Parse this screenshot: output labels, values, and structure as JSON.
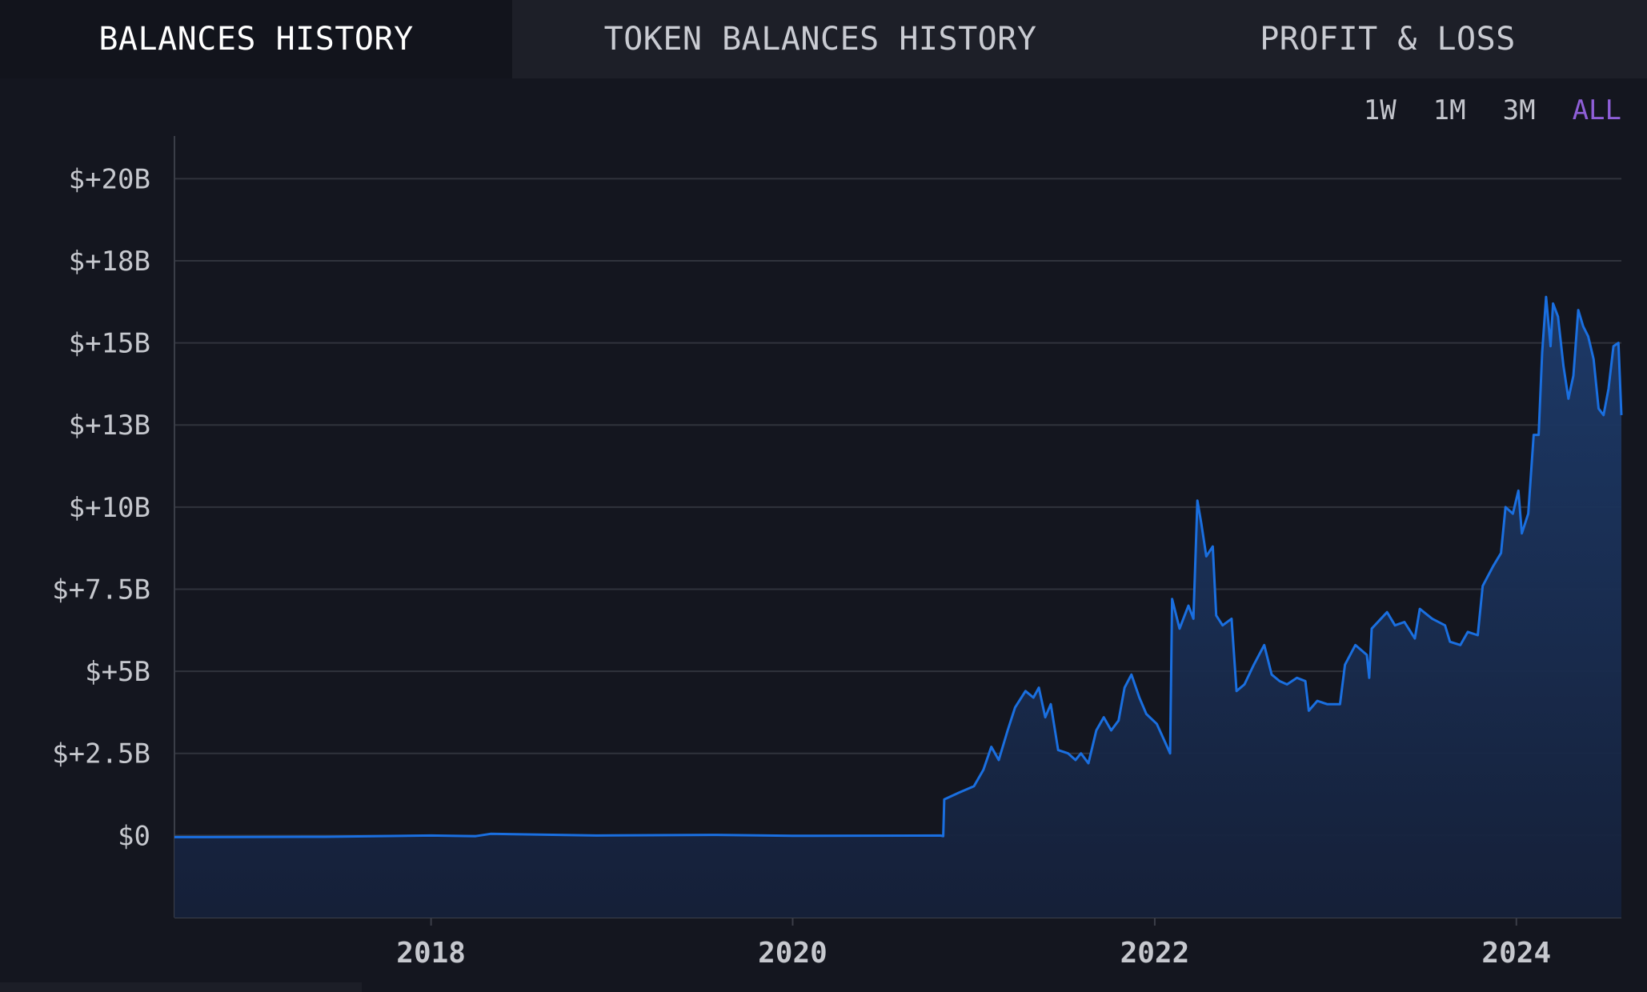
{
  "tabs": [
    {
      "label": "BALANCES HISTORY",
      "active": true
    },
    {
      "label": "TOKEN BALANCES HISTORY",
      "active": false
    },
    {
      "label": "PROFIT & LOSS",
      "active": false
    }
  ],
  "ranges": [
    {
      "label": "1W",
      "active": false
    },
    {
      "label": "1M",
      "active": false
    },
    {
      "label": "3M",
      "active": false
    },
    {
      "label": "ALL",
      "active": true
    }
  ],
  "colors": {
    "background": "#14161f",
    "line": "#1a6fe0",
    "area_top": "#1d3b6b",
    "area_bottom": "#152039",
    "grid": "#30333c",
    "active_range": "#8f5fd8"
  },
  "chart_data": {
    "type": "area",
    "title": "",
    "xlabel": "",
    "ylabel": "",
    "x_ticks": [
      "2018",
      "2020",
      "2022",
      "2024"
    ],
    "y_ticks": [
      {
        "value": 0,
        "label": "$0"
      },
      {
        "value": 2.5,
        "label": "$+2.5B"
      },
      {
        "value": 5,
        "label": "$+5B"
      },
      {
        "value": 7.5,
        "label": "$+7.5B"
      },
      {
        "value": 10,
        "label": "$+10B"
      },
      {
        "value": 12.5,
        "label": "$+13B"
      },
      {
        "value": 15,
        "label": "$+15B"
      },
      {
        "value": 17.5,
        "label": "$+18B"
      },
      {
        "value": 20,
        "label": "$+20B"
      }
    ],
    "xlim": [
      "2016-08-01",
      "2024-07-31"
    ],
    "ylim": [
      -2.5,
      21.3
    ],
    "grid": true,
    "series": [
      {
        "unit": "USD billions",
        "points": [
          [
            "2016-08-01",
            -0.05
          ],
          [
            "2017-06-01",
            -0.04
          ],
          [
            "2018-01-01",
            0.0
          ],
          [
            "2018-04-01",
            -0.02
          ],
          [
            "2018-05-01",
            0.05
          ],
          [
            "2018-12-01",
            0.0
          ],
          [
            "2019-08-01",
            0.02
          ],
          [
            "2020-01-01",
            -0.01
          ],
          [
            "2020-10-25",
            0.0
          ],
          [
            "2020-10-31",
            -0.02
          ],
          [
            "2020-11-02",
            1.1
          ],
          [
            "2020-12-01",
            1.3
          ],
          [
            "2021-01-01",
            1.5
          ],
          [
            "2021-01-20",
            2.0
          ],
          [
            "2021-02-05",
            2.7
          ],
          [
            "2021-02-20",
            2.3
          ],
          [
            "2021-03-10",
            3.2
          ],
          [
            "2021-03-25",
            3.9
          ],
          [
            "2021-04-15",
            4.4
          ],
          [
            "2021-05-01",
            4.2
          ],
          [
            "2021-05-12",
            4.5
          ],
          [
            "2021-05-25",
            3.6
          ],
          [
            "2021-06-05",
            4.0
          ],
          [
            "2021-06-20",
            2.6
          ],
          [
            "2021-07-10",
            2.5
          ],
          [
            "2021-07-25",
            2.3
          ],
          [
            "2021-08-05",
            2.5
          ],
          [
            "2021-08-20",
            2.2
          ],
          [
            "2021-09-05",
            3.2
          ],
          [
            "2021-09-20",
            3.6
          ],
          [
            "2021-10-05",
            3.2
          ],
          [
            "2021-10-20",
            3.5
          ],
          [
            "2021-11-01",
            4.5
          ],
          [
            "2021-11-15",
            4.9
          ],
          [
            "2021-12-01",
            4.2
          ],
          [
            "2021-12-15",
            3.7
          ],
          [
            "2022-01-05",
            3.4
          ],
          [
            "2022-01-20",
            2.9
          ],
          [
            "2022-02-01",
            2.5
          ],
          [
            "2022-02-05",
            7.2
          ],
          [
            "2022-02-20",
            6.3
          ],
          [
            "2022-03-10",
            7.0
          ],
          [
            "2022-03-20",
            6.6
          ],
          [
            "2022-03-28",
            10.2
          ],
          [
            "2022-04-05",
            9.5
          ],
          [
            "2022-04-15",
            8.5
          ],
          [
            "2022-04-28",
            8.8
          ],
          [
            "2022-05-05",
            6.7
          ],
          [
            "2022-05-18",
            6.4
          ],
          [
            "2022-06-05",
            6.6
          ],
          [
            "2022-06-15",
            4.4
          ],
          [
            "2022-07-01",
            4.6
          ],
          [
            "2022-07-20",
            5.2
          ],
          [
            "2022-08-10",
            5.8
          ],
          [
            "2022-08-25",
            4.9
          ],
          [
            "2022-09-10",
            4.7
          ],
          [
            "2022-09-25",
            4.6
          ],
          [
            "2022-10-15",
            4.8
          ],
          [
            "2022-11-01",
            4.7
          ],
          [
            "2022-11-08",
            3.8
          ],
          [
            "2022-11-25",
            4.1
          ],
          [
            "2022-12-15",
            4.0
          ],
          [
            "2023-01-10",
            4.0
          ],
          [
            "2023-01-20",
            5.2
          ],
          [
            "2023-02-10",
            5.8
          ],
          [
            "2023-03-05",
            5.5
          ],
          [
            "2023-03-10",
            4.8
          ],
          [
            "2023-03-15",
            6.3
          ],
          [
            "2023-04-15",
            6.8
          ],
          [
            "2023-05-01",
            6.4
          ],
          [
            "2023-05-20",
            6.5
          ],
          [
            "2023-06-10",
            6.0
          ],
          [
            "2023-06-20",
            6.9
          ],
          [
            "2023-07-15",
            6.6
          ],
          [
            "2023-08-10",
            6.4
          ],
          [
            "2023-08-20",
            5.9
          ],
          [
            "2023-09-10",
            5.8
          ],
          [
            "2023-09-25",
            6.2
          ],
          [
            "2023-10-15",
            6.1
          ],
          [
            "2023-10-25",
            7.6
          ],
          [
            "2023-11-15",
            8.2
          ],
          [
            "2023-12-01",
            8.6
          ],
          [
            "2023-12-10",
            10.0
          ],
          [
            "2023-12-25",
            9.8
          ],
          [
            "2024-01-05",
            10.5
          ],
          [
            "2024-01-12",
            9.2
          ],
          [
            "2024-01-25",
            9.8
          ],
          [
            "2024-02-05",
            12.2
          ],
          [
            "2024-02-15",
            12.2
          ],
          [
            "2024-02-22",
            14.7
          ],
          [
            "2024-03-01",
            16.4
          ],
          [
            "2024-03-10",
            14.9
          ],
          [
            "2024-03-15",
            16.2
          ],
          [
            "2024-03-25",
            15.8
          ],
          [
            "2024-04-05",
            14.3
          ],
          [
            "2024-04-15",
            13.3
          ],
          [
            "2024-04-25",
            14.0
          ],
          [
            "2024-05-05",
            16.0
          ],
          [
            "2024-05-15",
            15.5
          ],
          [
            "2024-05-25",
            15.2
          ],
          [
            "2024-06-05",
            14.5
          ],
          [
            "2024-06-15",
            13.0
          ],
          [
            "2024-06-25",
            12.8
          ],
          [
            "2024-07-05",
            13.6
          ],
          [
            "2024-07-15",
            14.9
          ],
          [
            "2024-07-25",
            15.0
          ],
          [
            "2024-07-31",
            12.8
          ]
        ]
      }
    ]
  }
}
